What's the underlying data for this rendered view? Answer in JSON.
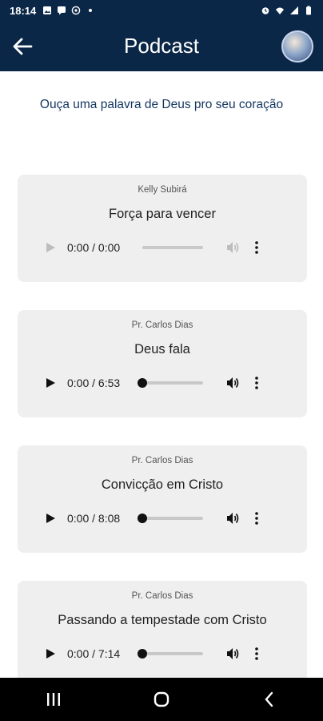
{
  "status": {
    "time": "18:14",
    "left_icons": [
      "image-icon",
      "message-icon",
      "whatsapp-icon",
      "dot-icon"
    ],
    "right_icons": [
      "alarm-icon",
      "wifi-icon",
      "signal-icon",
      "battery-icon"
    ]
  },
  "header": {
    "title": "Podcast",
    "back_icon": "arrow-left-icon",
    "avatar_icon": "logo-avatar"
  },
  "subtitle": "Ouça uma palavra de Deus pro seu coração",
  "podcasts": [
    {
      "author": "Kelly Subirá",
      "title": "Força para vencer",
      "time": "0:00 / 0:00",
      "progress": 0,
      "enabled": false
    },
    {
      "author": "Pr. Carlos Dias",
      "title": "Deus fala",
      "time": "0:00 / 6:53",
      "progress": 0,
      "enabled": true
    },
    {
      "author": "Pr. Carlos Dias",
      "title": "Convicção em Cristo",
      "time": "0:00 / 8:08",
      "progress": 0,
      "enabled": true
    },
    {
      "author": "Pr. Carlos Dias",
      "title": "Passando a tempestade com Cristo",
      "time": "0:00 / 7:14",
      "progress": 0,
      "enabled": true
    }
  ],
  "navbar": {
    "items": [
      "recent-apps-icon",
      "home-icon",
      "back-icon"
    ]
  },
  "colors": {
    "header_bg": "#0b2747",
    "subtitle": "#13355e",
    "card_bg": "#efefef"
  }
}
